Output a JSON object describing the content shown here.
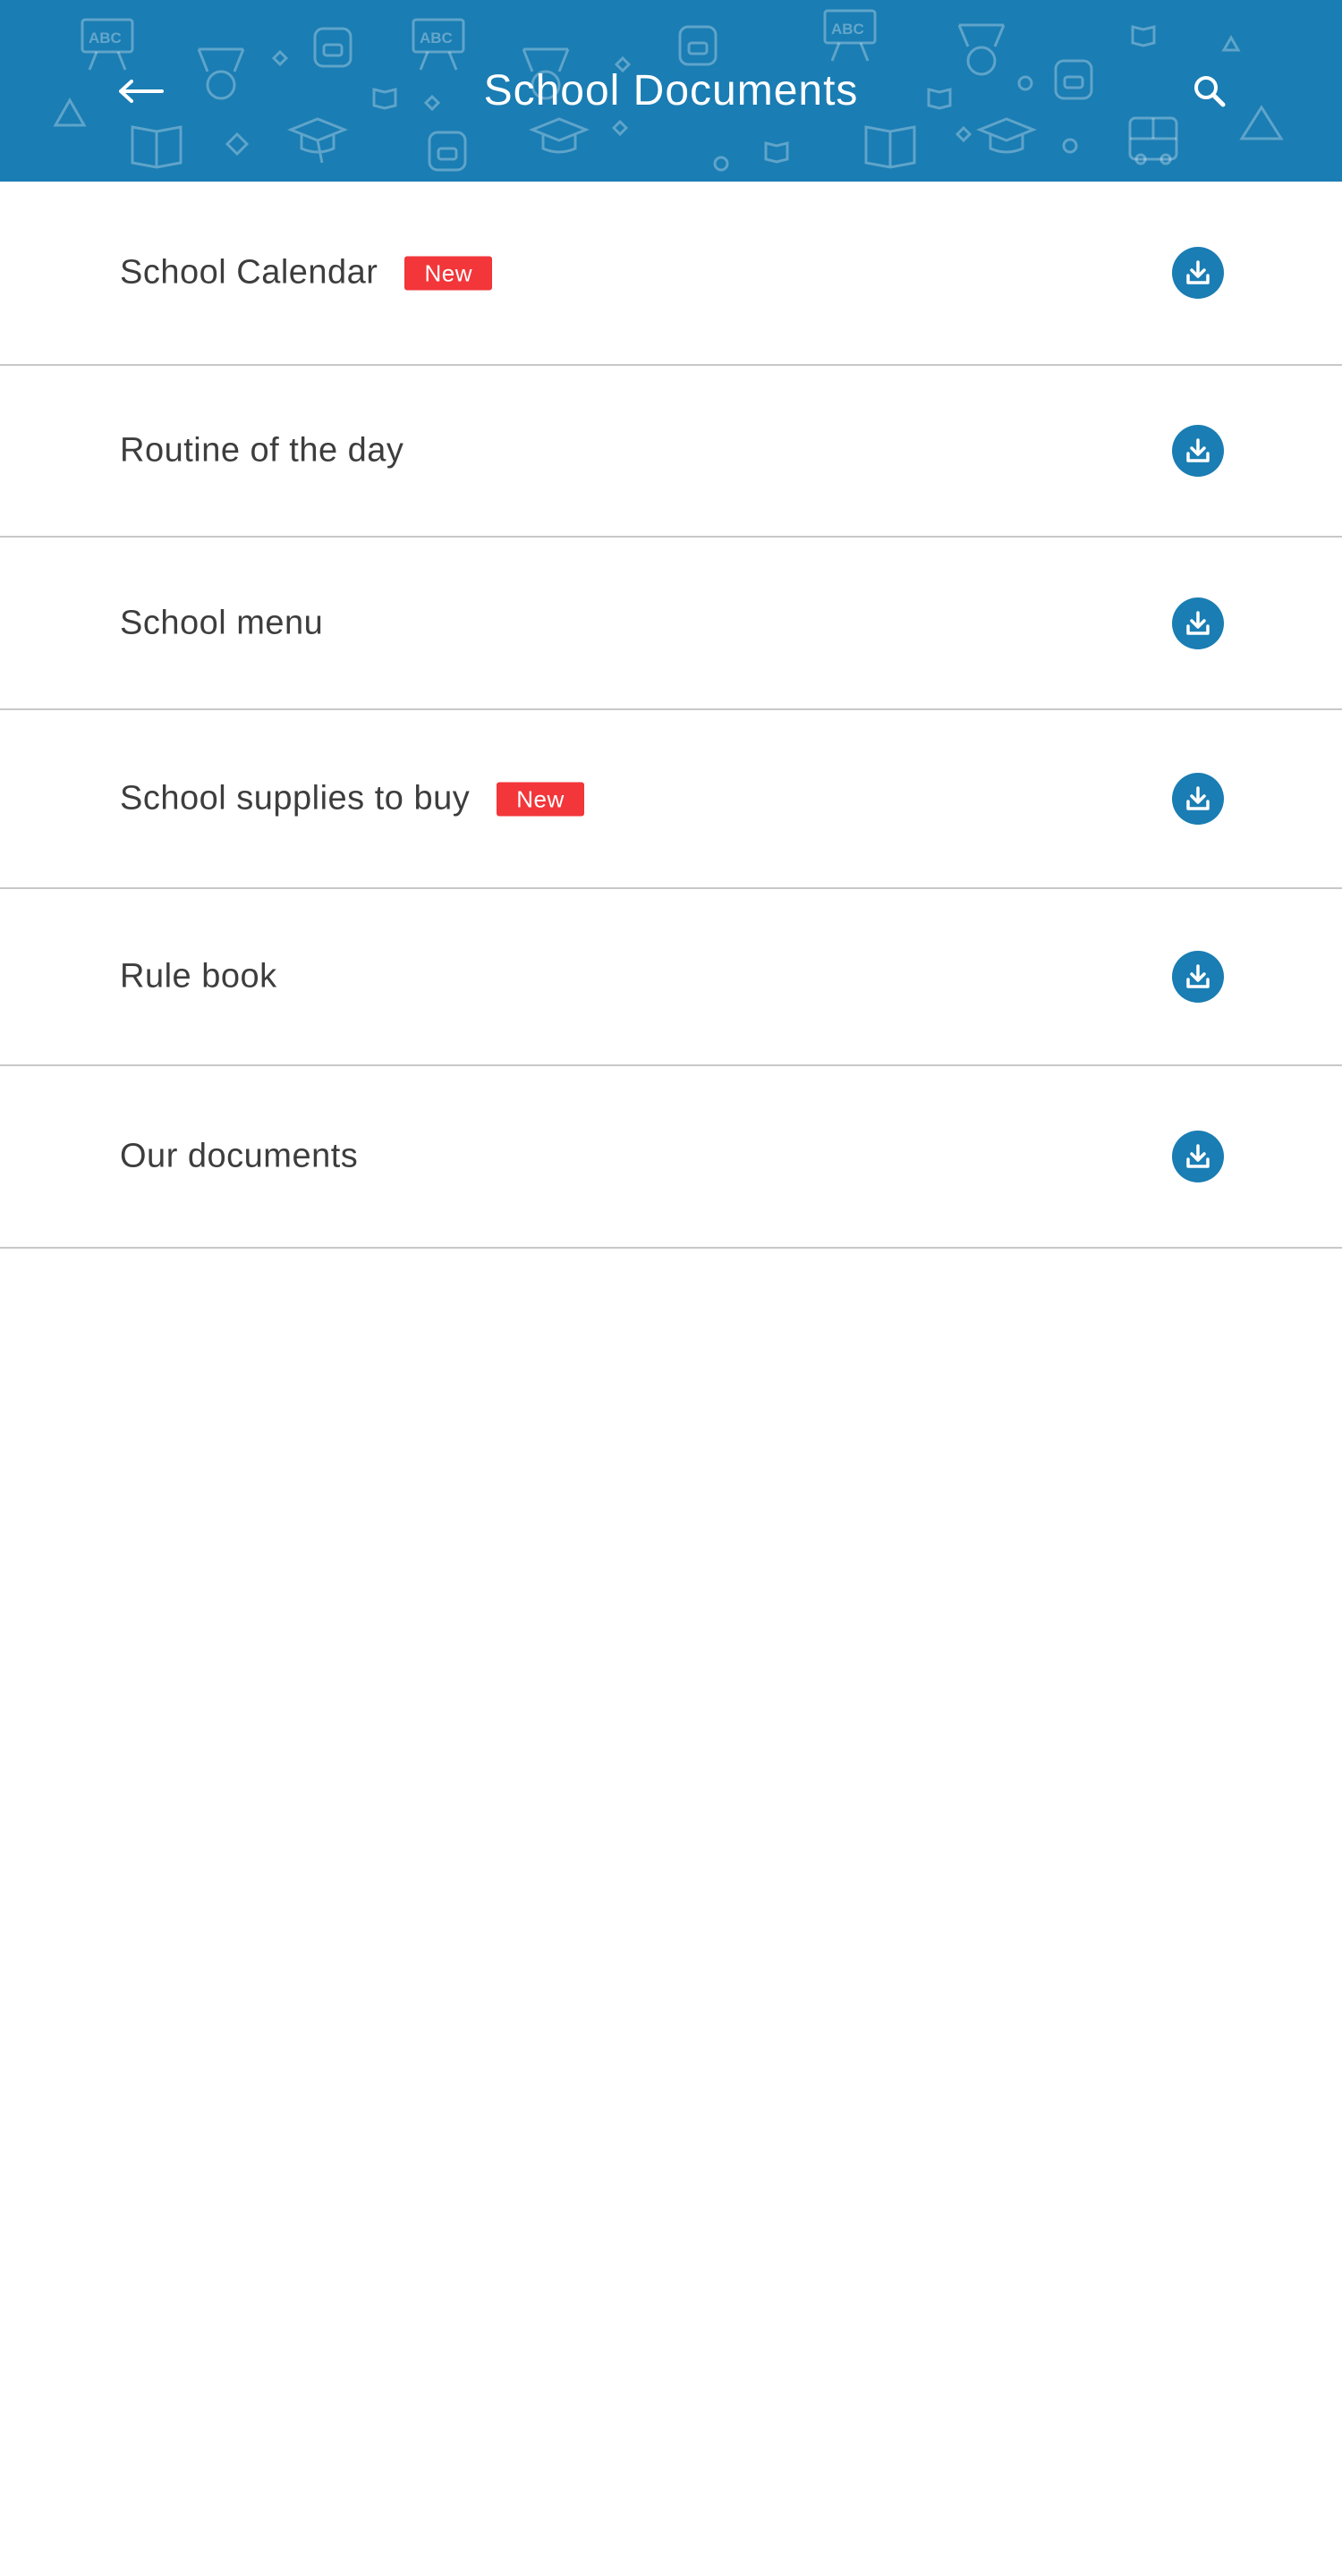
{
  "header": {
    "title": "School Documents",
    "back_icon": "arrow-left-icon",
    "search_icon": "search-icon",
    "background_color": "#1a7db3"
  },
  "documents": [
    {
      "label": "School Calendar",
      "badge": "New"
    },
    {
      "label": "Routine of the day",
      "badge": ""
    },
    {
      "label": "School menu",
      "badge": ""
    },
    {
      "label": "School supplies to buy",
      "badge": "New"
    },
    {
      "label": "Rule book",
      "badge": ""
    },
    {
      "label": "Our documents",
      "badge": ""
    }
  ],
  "colors": {
    "accent": "#1a7db3",
    "badge": "#f2363a",
    "text": "#3d3d3d",
    "divider": "#c8c8c8"
  },
  "pattern_text": "ABC"
}
